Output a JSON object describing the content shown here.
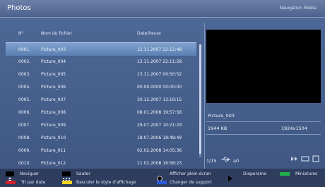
{
  "header": {
    "title": "Photos",
    "section": "Navigation Média"
  },
  "table": {
    "columns": [
      "N°",
      "Nom du fichier",
      "Date/heure"
    ],
    "rows": [
      {
        "num": "0001.",
        "name": "Picture_003",
        "date": "12.11.2007 22:12:48"
      },
      {
        "num": "0002.",
        "name": "Picture_004",
        "date": "12.11.2007 22:11:28"
      },
      {
        "num": "0003.",
        "name": "Picture_005",
        "date": "13.11.2007 00:50:52"
      },
      {
        "num": "0004.",
        "name": "Picture_006",
        "date": "00.00.0000 00:00:00"
      },
      {
        "num": "0005.",
        "name": "Picture_007",
        "date": "30.12.2007 13:19:15"
      },
      {
        "num": "0006.",
        "name": "Picture_008",
        "date": "08.01.2008 19:57:58"
      },
      {
        "num": "0007.",
        "name": "Picture_009",
        "date": "29.07.2007 10:21:29"
      },
      {
        "num": "0008.",
        "name": "Picture_010",
        "date": "18.07.2006 18:48:49"
      },
      {
        "num": "0009.",
        "name": "Picture_011",
        "date": "02.02.2008 14:05:36"
      },
      {
        "num": "0010.",
        "name": "Picture_012",
        "date": "11.02.2008 16:58:23"
      }
    ],
    "selected_index": 0
  },
  "details": {
    "filename": "Picture_003",
    "size": "1944 KB",
    "resolution": "1924x1504",
    "page": "1/15",
    "usb_label": "a0"
  },
  "legend": {
    "navigate": "Naviguer",
    "jump": "Sauter",
    "fullscreen": "Afficher plein écran",
    "slideshow": "Diaporama",
    "thumbnails": "Miniatures",
    "sort": "Tri par date",
    "toggle_style": "Basculer le style d'affichage",
    "change_source": "Changer de support"
  },
  "colors": {
    "red": "#d0202a",
    "green": "#22b14c",
    "yellow": "#f4d21f",
    "blue": "#2a5bd7"
  },
  "icons": [
    "usb-icon",
    "slideshow-ctrl-icon",
    "repeat-icon",
    "stop-icon",
    "updown-arrows-icon",
    "numeric-keys-icon",
    "ok-icon",
    "play-icon"
  ]
}
